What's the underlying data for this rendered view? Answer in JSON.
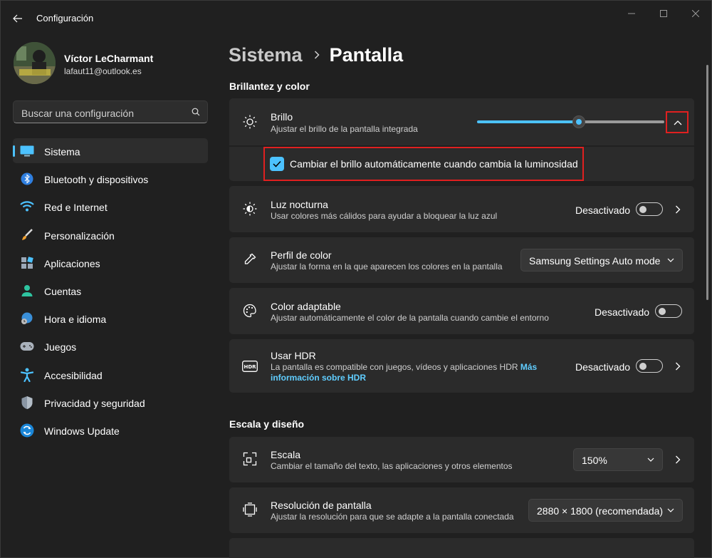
{
  "window": {
    "title": "Configuración"
  },
  "profile": {
    "name": "Víctor LeCharmant",
    "email": "lafaut11@outlook.es"
  },
  "search": {
    "placeholder": "Buscar una configuración"
  },
  "sidebar": {
    "items": [
      {
        "label": "Sistema",
        "icon": "system-icon",
        "active": true
      },
      {
        "label": "Bluetooth y dispositivos",
        "icon": "bluetooth-icon"
      },
      {
        "label": "Red e Internet",
        "icon": "wifi-icon"
      },
      {
        "label": "Personalización",
        "icon": "brush-icon"
      },
      {
        "label": "Aplicaciones",
        "icon": "apps-icon"
      },
      {
        "label": "Cuentas",
        "icon": "account-icon"
      },
      {
        "label": "Hora e idioma",
        "icon": "time-language-icon"
      },
      {
        "label": "Juegos",
        "icon": "gamepad-icon"
      },
      {
        "label": "Accesibilidad",
        "icon": "accessibility-icon"
      },
      {
        "label": "Privacidad y seguridad",
        "icon": "shield-icon"
      },
      {
        "label": "Windows Update",
        "icon": "update-icon"
      }
    ]
  },
  "breadcrumb": {
    "parent": "Sistema",
    "current": "Pantalla"
  },
  "brightness_section": {
    "title": "Brillantez y color",
    "brightness": {
      "title": "Brillo",
      "desc": "Ajustar el brillo de la pantalla integrada",
      "level": 0.67
    },
    "auto_brightness": {
      "label": "Cambiar el brillo automáticamente cuando cambia la luminosidad",
      "checked": true
    },
    "night_light": {
      "title": "Luz nocturna",
      "desc": "Usar colores más cálidos para ayudar a bloquear la luz azul",
      "state": "Desactivado"
    },
    "color_profile": {
      "title": "Perfil de color",
      "desc": "Ajustar la forma en la que aparecen los colores en la pantalla",
      "value": "Samsung Settings Auto mode"
    },
    "adaptive_color": {
      "title": "Color adaptable",
      "desc": "Ajustar automáticamente el color de la pantalla cuando cambie el entorno",
      "state": "Desactivado"
    },
    "hdr": {
      "title": "Usar HDR",
      "desc": "La pantalla es compatible con juegos, vídeos y aplicaciones HDR",
      "link": "Más información sobre HDR",
      "state": "Desactivado"
    }
  },
  "scale_section": {
    "title": "Escala y diseño",
    "scale": {
      "title": "Escala",
      "desc": "Cambiar el tamaño del texto, las aplicaciones y otros elementos",
      "value": "150%"
    },
    "resolution": {
      "title": "Resolución de pantalla",
      "desc": "Ajustar la resolución para que se adapte a la pantalla conectada",
      "value": "2880 × 1800 (recomendada)"
    }
  },
  "colors": {
    "accent": "#4cc2ff",
    "highlight": "#e02020",
    "link": "#60cdff"
  }
}
